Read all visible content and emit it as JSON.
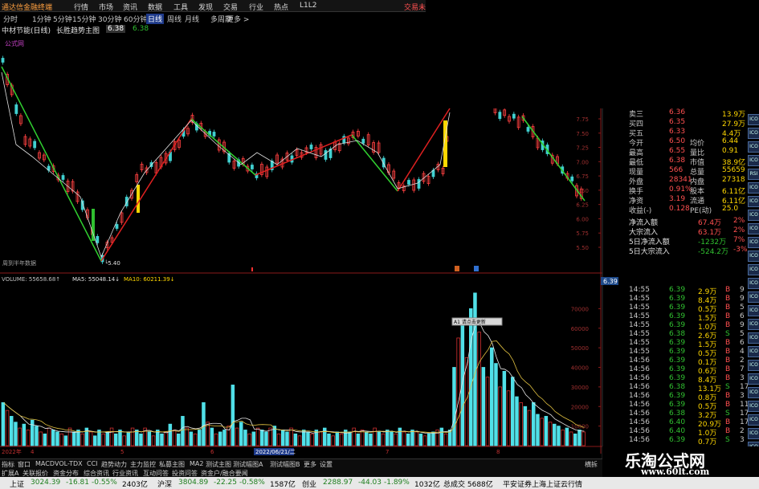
{
  "window": {
    "title": "通达信金融终端",
    "menu": [
      "行情",
      "市场",
      "资讯",
      "数据",
      "工具",
      "发现",
      "交易",
      "行业",
      "热点",
      "L1L2"
    ],
    "trade_label": "交易未"
  },
  "toolbar": {
    "tabs": [
      "分时",
      "1分钟",
      "5分钟",
      "15分钟",
      "30分钟",
      "60分钟",
      "日线",
      "周线",
      "月线",
      "多周期",
      "更多 >"
    ]
  },
  "chart_header": {
    "name": "中材节能(日线)",
    "indicator": "长胜趋势主图",
    "value1": "6.38",
    "value2": "6.38",
    "sub_label": "公式网",
    "low_label": "5.40",
    "bottom_left": "周到半年数据",
    "current_price_tag": "6.39"
  },
  "price_axis": [
    "7.75",
    "7.50",
    "7.25",
    "7.00",
    "6.75",
    "6.50",
    "6.25",
    "6.00",
    "5.75",
    "5.50"
  ],
  "volume_header": {
    "volume": "VOLUME: 55658.68↑",
    "ma5": "MA5: 55048.14↓",
    "ma10": "MA10: 60211.39↓"
  },
  "volume_axis": [
    "70000",
    "60000",
    "50000",
    "40000",
    "30000",
    "20000",
    "10000"
  ],
  "popup_label": "A1 请点击更新",
  "date_axis": {
    "year": "2022年",
    "marks": [
      "4",
      "5",
      "6",
      "7",
      "8"
    ],
    "highlight": "2022/06/21/二"
  },
  "quote_panel": [
    {
      "l1": "卖三",
      "v1": "6.36",
      "l2": "",
      "v2": "13.9万"
    },
    {
      "l1": "买四",
      "v1": "6.35",
      "l2": "",
      "v2": "27.9万"
    },
    {
      "l1": "买五",
      "v1": "6.33",
      "l2": "",
      "v2": "4.4万"
    },
    {
      "l1": "今开",
      "v1": "6.50",
      "l2": "均价",
      "v2": "6.44"
    },
    {
      "l1": "最高",
      "v1": "6.55",
      "l2": "量比",
      "v2": "0.91"
    },
    {
      "l1": "最低",
      "v1": "6.38",
      "l2": "市值",
      "v2": "38.9亿"
    },
    {
      "l1": "现量",
      "v1": "566",
      "l2": "总量",
      "v2": "55659"
    },
    {
      "l1": "外盘",
      "v1": "28341",
      "l2": "内盘",
      "v2": "27318"
    },
    {
      "l1": "换手",
      "v1": "0.91%",
      "l2": "股本",
      "v2": "6.11亿"
    },
    {
      "l1": "净资",
      "v1": "3.19",
      "l2": "流通",
      "v2": "6.11亿"
    },
    {
      "l1": "收益(-)",
      "v1": "0.128",
      "l2": "PE(动)",
      "v2": "25.0"
    }
  ],
  "flow_panel": [
    {
      "label": "净流入额",
      "value": "67.4万",
      "pct": "2%"
    },
    {
      "label": "大宗流入",
      "value": "63.1万",
      "pct": "2%"
    },
    {
      "label": "5日净流入额",
      "value": "-1232万",
      "pct": "7%"
    },
    {
      "label": "5日大宗流入",
      "value": "-524.2万",
      "pct": "-3%"
    }
  ],
  "ticks": [
    {
      "t": "14:55",
      "p": "6.39",
      "v": "2.9万",
      "s": "B",
      "n": "9"
    },
    {
      "t": "14:55",
      "p": "6.39",
      "v": "8.4万",
      "s": "B",
      "n": "9"
    },
    {
      "t": "14:55",
      "p": "6.39",
      "v": "0.5万",
      "s": "B",
      "n": "5"
    },
    {
      "t": "14:55",
      "p": "6.39",
      "v": "1.5万",
      "s": "B",
      "n": "6"
    },
    {
      "t": "14:55",
      "p": "6.39",
      "v": "1.0万",
      "s": "B",
      "n": "9"
    },
    {
      "t": "14:55",
      "p": "6.38",
      "v": "2.6万",
      "s": "S",
      "n": "5"
    },
    {
      "t": "14:55",
      "p": "6.39",
      "v": "1.5万",
      "s": "B",
      "n": "6"
    },
    {
      "t": "14:55",
      "p": "6.39",
      "v": "0.5万",
      "s": "B",
      "n": "4"
    },
    {
      "t": "14:56",
      "p": "6.39",
      "v": "0.1万",
      "s": "B",
      "n": "2"
    },
    {
      "t": "14:56",
      "p": "6.39",
      "v": "0.6万",
      "s": "B",
      "n": "7"
    },
    {
      "t": "14:56",
      "p": "6.39",
      "v": "8.4万",
      "s": "B",
      "n": "3"
    },
    {
      "t": "14:56",
      "p": "6.38",
      "v": "13.1万",
      "s": "S",
      "n": "17"
    },
    {
      "t": "14:56",
      "p": "6.39",
      "v": "0.8万",
      "s": "B",
      "n": "3"
    },
    {
      "t": "14:56",
      "p": "6.39",
      "v": "0.5万",
      "s": "B",
      "n": "11"
    },
    {
      "t": "14:56",
      "p": "6.38",
      "v": "3.2万",
      "s": "S",
      "n": "17"
    },
    {
      "t": "14:56",
      "p": "6.40",
      "v": "20.9万",
      "s": "B",
      "n": "17"
    },
    {
      "t": "14:56",
      "p": "6.40",
      "v": "1.0万",
      "s": "B",
      "n": "2"
    },
    {
      "t": "14:56",
      "p": "6.39",
      "v": "0.7万",
      "s": "S",
      "n": "3"
    }
  ],
  "right_icons": [
    "ICO",
    "ICO",
    "ICO",
    "ICO",
    "RSI",
    "ICO",
    "ICO",
    "ICO",
    "ICO",
    "ICO",
    "ICO",
    "ICO",
    "ICO",
    "ICO",
    "ICO",
    "ICO",
    "ICO",
    "ICO",
    "ICO",
    "ICO",
    "ICO",
    "ICO",
    "ICO",
    "ICO",
    "ICO"
  ],
  "bottom_tabs": [
    "指标",
    "窗口",
    "MACD",
    "VOL-TDX",
    "CCI",
    "趋势动力",
    "主力监控",
    "私募主图",
    "MA2",
    "测试主图",
    "测试幅图A",
    "测试幅图B",
    "更多",
    "设置"
  ],
  "bottom_tabs2": [
    "扩展A",
    "关联报价",
    "资金分布",
    "综合资讯",
    "行业资讯",
    "互动问答",
    "投资问答",
    "资金户/融合要闻"
  ],
  "bottom_right": "横拆",
  "status_bar": [
    {
      "label": "上证",
      "v": "3024.39",
      "c": "-16.81",
      "p": "-0.55%",
      "amt": "2403亿"
    },
    {
      "label": "沪深",
      "v": "3804.89",
      "c": "-22.25",
      "p": "-0.58%",
      "amt": "1587亿"
    },
    {
      "label": "创业",
      "v": "2288.97",
      "c": "-44.03",
      "p": "-1.89%",
      "amt": "1032亿"
    }
  ],
  "status_total": "总成交 5688亿",
  "status_news": "平安证券上海上证云行情",
  "watermark": {
    "title": "乐淘公式网",
    "url": "www.60lt.com"
  },
  "colors": {
    "up": "#ff4040",
    "down": "#40d0d0",
    "green": "#30c030",
    "yellow": "#ffd700",
    "bg": "#000000",
    "axis_red": "#8a1a1a"
  },
  "chart_data": {
    "type": "bar",
    "title": "VOLUME",
    "ylabel": "",
    "ylim": [
      0,
      80000
    ],
    "series_name": "VOLUME",
    "values": [
      22000,
      18000,
      15000,
      12000,
      9000,
      11000,
      8000,
      13000,
      10000,
      7000,
      6000,
      9000,
      8000,
      7000,
      6000,
      5000,
      9000,
      7000,
      8000,
      6000,
      9000,
      7000,
      5000,
      8000,
      6000,
      7000,
      9000,
      6000,
      8000,
      5000,
      7000,
      9000,
      8000,
      6000,
      9000,
      7000,
      5000,
      8000,
      6000,
      7000,
      11000,
      8000,
      6000,
      15000,
      9000,
      7000,
      6000,
      8000,
      22000,
      12000,
      9000,
      6000,
      7000,
      8000,
      10000,
      31000,
      9000,
      12000,
      8000,
      6000,
      7000,
      9000,
      8000,
      7000,
      9000,
      10000,
      6000,
      8000,
      7000,
      9000,
      6000,
      5000,
      8000,
      7000,
      6000,
      8000,
      7000,
      9000,
      6000,
      5000,
      7000,
      6000,
      8000,
      7000,
      9000,
      6000,
      8000,
      7000,
      6000,
      9000,
      7000,
      6000,
      8000,
      7000,
      6000,
      9000,
      7000,
      6000,
      8000,
      7000,
      6000,
      5000,
      6000,
      7000,
      8000,
      9000,
      6000,
      8000,
      40000,
      55000,
      62000,
      45000,
      70000,
      78000,
      58000,
      40000,
      35000,
      50000,
      42000,
      30000,
      38000,
      28000,
      35000,
      25000,
      22000,
      20000,
      18000,
      22000,
      16000,
      14000,
      15000,
      12000,
      11000,
      10000,
      8000,
      9000,
      7000,
      6000,
      8000,
      7000
    ]
  }
}
